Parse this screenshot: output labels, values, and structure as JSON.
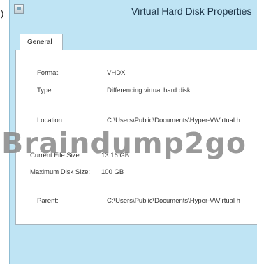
{
  "prefix": ")",
  "window": {
    "title": "Virtual Hard Disk Properties",
    "tab": "General"
  },
  "properties": {
    "format": {
      "label": "Format:",
      "value": "VHDX"
    },
    "type": {
      "label": "Type:",
      "value": "Differencing virtual hard disk"
    },
    "location": {
      "label": "Location:",
      "value": "C:\\Users\\Public\\Documents\\Hyper-V\\Virtual h"
    },
    "file_size": {
      "label": "Current File Size:",
      "value": "13.16 GB"
    },
    "max_size": {
      "label": "Maximum Disk Size:",
      "value": "100 GB"
    },
    "parent": {
      "label": "Parent:",
      "value": "C:\\Users\\Public\\Documents\\Hyper-V\\Virtual h"
    }
  },
  "watermark": "Braindump2go",
  "icons": {
    "app": "virtual-disk-icon"
  },
  "colors": {
    "titlebar": "#bfe4f4",
    "panel": "#ffffff"
  }
}
